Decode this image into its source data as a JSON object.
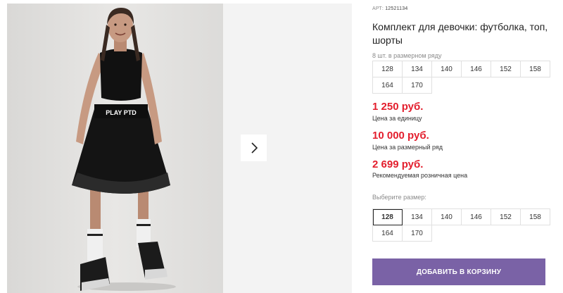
{
  "product": {
    "sku_label": "АРТ:",
    "sku_value": "12521134",
    "title": "Комплект для девочки: футболка, топ, шорты",
    "skirt_logo": "PLAY PTD"
  },
  "size_row": {
    "note": "8 шт. в размерном ряду",
    "sizes": [
      "128",
      "134",
      "140",
      "146",
      "152",
      "158",
      "164",
      "170"
    ]
  },
  "prices": {
    "unit_price": "1 250 руб.",
    "unit_label": "Цена за единицу",
    "row_price": "10 000 руб.",
    "row_label": "Цена за размерный ряд",
    "retail_price": "2 699 руб.",
    "retail_label": "Рекомендуемая розничная цена"
  },
  "size_select": {
    "label": "Выберите размер:",
    "sizes": [
      "128",
      "134",
      "140",
      "146",
      "152",
      "158",
      "164",
      "170"
    ],
    "selected": "128"
  },
  "cart_button": {
    "label": "ДОБАВИТЬ В КОРЗИНУ"
  },
  "colors": {
    "accent": "#7a62a6",
    "price": "#e31e2d"
  },
  "icons": {
    "next": "chevron-right-icon"
  }
}
